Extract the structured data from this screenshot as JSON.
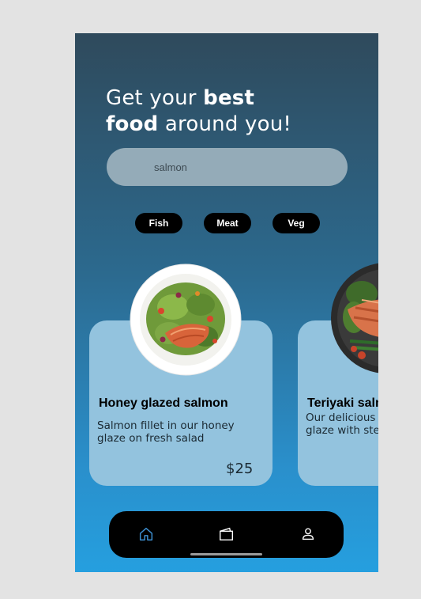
{
  "header": {
    "line1_regular": "Get your ",
    "line1_bold": "best",
    "line2_bold": "food",
    "line2_regular": " around you!"
  },
  "search": {
    "value": "salmon"
  },
  "categories": [
    {
      "label": "Fish"
    },
    {
      "label": "Meat"
    },
    {
      "label": "Veg"
    }
  ],
  "cards": [
    {
      "title": "Honey glazed salmon",
      "description": "Salmon fillet in our honey glaze on fresh salad",
      "price": "$25"
    },
    {
      "title": "Teriyaki salmon",
      "description": "Our delicious salmon in teriyaki glaze with steamed vegetables",
      "price": ""
    }
  ],
  "bottom_nav": {
    "items": [
      {
        "icon": "home-icon",
        "active": true
      },
      {
        "icon": "wallet-icon",
        "active": false
      },
      {
        "icon": "user-icon",
        "active": false
      }
    ]
  },
  "colors": {
    "active_icon": "#3d8fd1",
    "card_bg": "#93c3de",
    "search_bg": "#94abb8"
  }
}
